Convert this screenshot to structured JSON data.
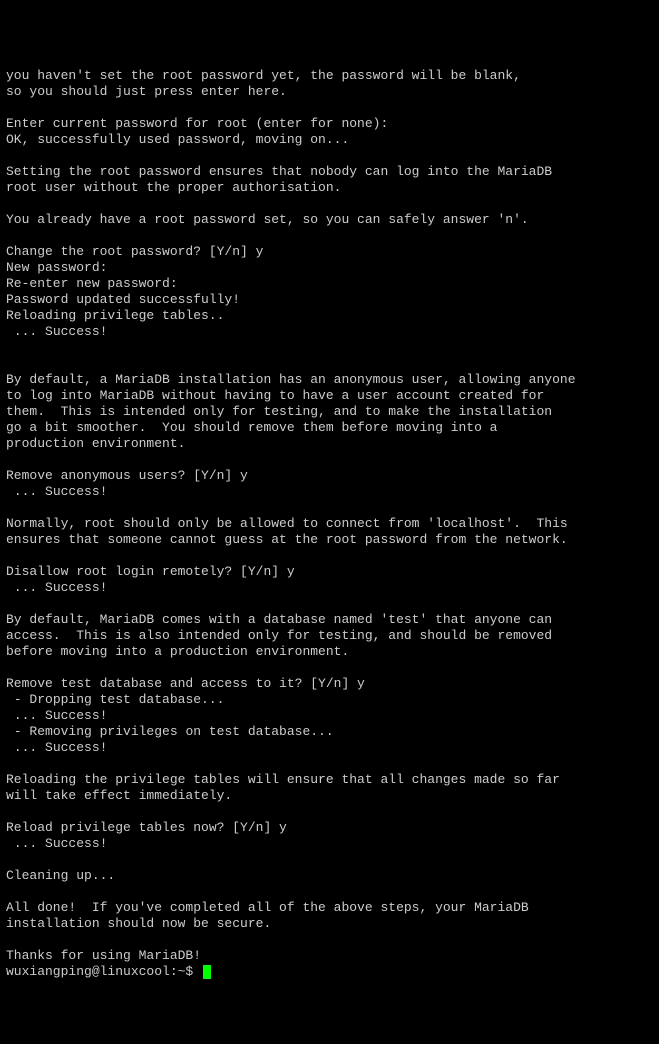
{
  "terminal": {
    "lines": [
      "you haven't set the root password yet, the password will be blank,",
      "so you should just press enter here.",
      "",
      "Enter current password for root (enter for none):",
      "OK, successfully used password, moving on...",
      "",
      "Setting the root password ensures that nobody can log into the MariaDB",
      "root user without the proper authorisation.",
      "",
      "You already have a root password set, so you can safely answer 'n'.",
      "",
      "Change the root password? [Y/n] y",
      "New password:",
      "Re-enter new password:",
      "Password updated successfully!",
      "Reloading privilege tables..",
      " ... Success!",
      "",
      "",
      "By default, a MariaDB installation has an anonymous user, allowing anyone",
      "to log into MariaDB without having to have a user account created for",
      "them.  This is intended only for testing, and to make the installation",
      "go a bit smoother.  You should remove them before moving into a",
      "production environment.",
      "",
      "Remove anonymous users? [Y/n] y",
      " ... Success!",
      "",
      "Normally, root should only be allowed to connect from 'localhost'.  This",
      "ensures that someone cannot guess at the root password from the network.",
      "",
      "Disallow root login remotely? [Y/n] y",
      " ... Success!",
      "",
      "By default, MariaDB comes with a database named 'test' that anyone can",
      "access.  This is also intended only for testing, and should be removed",
      "before moving into a production environment.",
      "",
      "Remove test database and access to it? [Y/n] y",
      " - Dropping test database...",
      " ... Success!",
      " - Removing privileges on test database...",
      " ... Success!",
      "",
      "Reloading the privilege tables will ensure that all changes made so far",
      "will take effect immediately.",
      "",
      "Reload privilege tables now? [Y/n] y",
      " ... Success!",
      "",
      "Cleaning up...",
      "",
      "All done!  If you've completed all of the above steps, your MariaDB",
      "installation should now be secure.",
      "",
      "Thanks for using MariaDB!"
    ],
    "prompt": "wuxiangping@linuxcool:~$ "
  }
}
